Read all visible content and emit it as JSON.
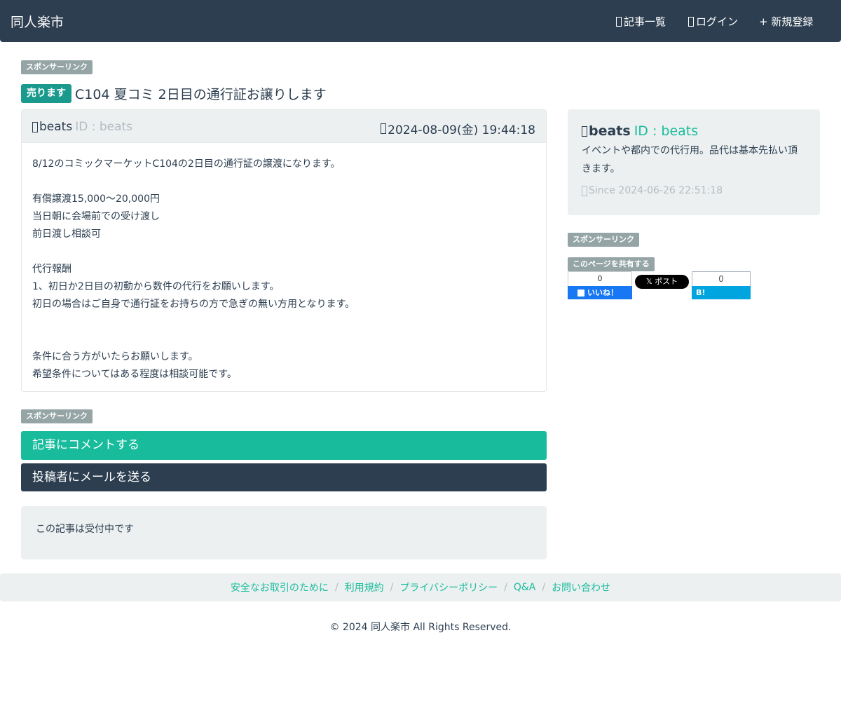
{
  "navbar": {
    "brand": "同人楽市",
    "items": [
      {
        "label": "記事一覧",
        "icon": "list-icon"
      },
      {
        "label": "ログイン",
        "icon": "login-icon"
      },
      {
        "label": "+ 新規登録",
        "icon": ""
      }
    ]
  },
  "sponsor_label": "スポンサーリンク",
  "post": {
    "tag": "売ります",
    "title": "C104 夏コミ 2日目の通行証お譲りします",
    "user": "beats",
    "user_id": "ID : beats",
    "date": "2024-08-09(金) 19:44:18",
    "body": [
      "8/12のコミックマーケットC104の2日目の通行証の譲渡になります。",
      "",
      "有償譲渡15,000〜20,000円",
      "当日朝に会場前での受け渡し",
      "前日渡し相談可",
      "",
      "代行報酬",
      "1、初日か2日目の初動から数件の代行をお願いします。",
      "初日の場合はご自身で通行証をお持ちの方で急ぎの無い方用となります。",
      "",
      "",
      "条件に合う方がいたらお願いします。",
      "希望条件についてはある程度は相談可能です。"
    ]
  },
  "profile": {
    "user": "beats",
    "user_id": "ID : beats",
    "description": "イベントや都内での代行用。品代は基本先払い頂きます。",
    "since": "Since 2024-06-26 22:51:18"
  },
  "share": {
    "label": "このページを共有する",
    "fb_count": "0",
    "fb_label": "いいね！",
    "x_label": "ポスト",
    "hatena_count": "0",
    "hatena_label": "B! Bookmark"
  },
  "actions": {
    "comment": "記事にコメントする",
    "mail": "投稿者にメールを送る"
  },
  "status": "この記事は受付中です",
  "footer": {
    "links": [
      "安全なお取引のために",
      "利用規約",
      "プライバシーポリシー",
      "Q&A",
      "お問い合わせ"
    ],
    "copyright": "© 2024 同人楽市 All Rights Reserved."
  },
  "colors": {
    "navbar": "#2c3e50",
    "accent": "#1abc9c",
    "tag": "#1a9a8c",
    "muted": "#95a5a6",
    "panel": "#ecf0f1"
  }
}
